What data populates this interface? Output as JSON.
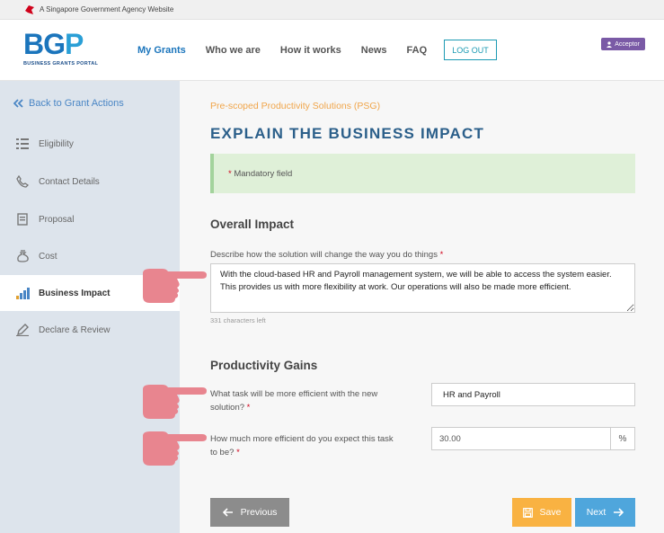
{
  "gov_bar": {
    "text": "A Singapore Government Agency Website"
  },
  "header": {
    "logo": {
      "mark_b": "BG",
      "mark_p": "P",
      "subtitle": "BUSINESS GRANTS PORTAL"
    },
    "nav": [
      {
        "label": "My Grants",
        "active": true
      },
      {
        "label": "Who we are",
        "active": false
      },
      {
        "label": "How it works",
        "active": false
      },
      {
        "label": "News",
        "active": false
      },
      {
        "label": "FAQ",
        "active": false
      }
    ],
    "logout_label": "LOG OUT",
    "role_label": "Acceptor"
  },
  "sidebar": {
    "back_label": "Back to Grant Actions",
    "items": [
      {
        "label": "Eligibility",
        "icon": "list-icon",
        "active": false
      },
      {
        "label": "Contact Details",
        "icon": "phone-icon",
        "active": false
      },
      {
        "label": "Proposal",
        "icon": "document-icon",
        "active": false
      },
      {
        "label": "Cost",
        "icon": "money-bag-icon",
        "active": false
      },
      {
        "label": "Business Impact",
        "icon": "bar-chart-icon",
        "active": true
      },
      {
        "label": "Declare & Review",
        "icon": "pen-icon",
        "active": false
      }
    ]
  },
  "main": {
    "scheme": "Pre-scoped Productivity Solutions (PSG)",
    "title": "EXPLAIN THE BUSINESS IMPACT",
    "mandatory_text": "Mandatory field",
    "overall_impact": {
      "title": "Overall Impact",
      "label": "Describe how the solution will change the way you do things",
      "value": "With the cloud-based HR and Payroll management system, we will be able to access the system easier. This provides us with more flexibility at work. Our operations will also be made more efficient.",
      "char_count": "331 characters left"
    },
    "productivity_gains": {
      "title": "Productivity Gains",
      "task_label_1": "What task will be more efficient with the new",
      "task_label_2": "solution?",
      "task_value": "HR and Payroll",
      "efficiency_label_1": "How much more efficient do you expect this task",
      "efficiency_label_2": "to be?",
      "efficiency_value": "30.00",
      "efficiency_unit": "%"
    },
    "buttons": {
      "previous": "Previous",
      "save": "Save",
      "next": "Next"
    }
  },
  "colors": {
    "brand_blue": "#1b75bc",
    "scheme_orange": "#f0a54a",
    "title_blue": "#2b5f8a",
    "save_orange": "#f9b242",
    "next_blue": "#4fa6dc",
    "previous_grey": "#8c8c8c",
    "annotation_hand": "#e8858f",
    "required_star": "#d0021b"
  }
}
